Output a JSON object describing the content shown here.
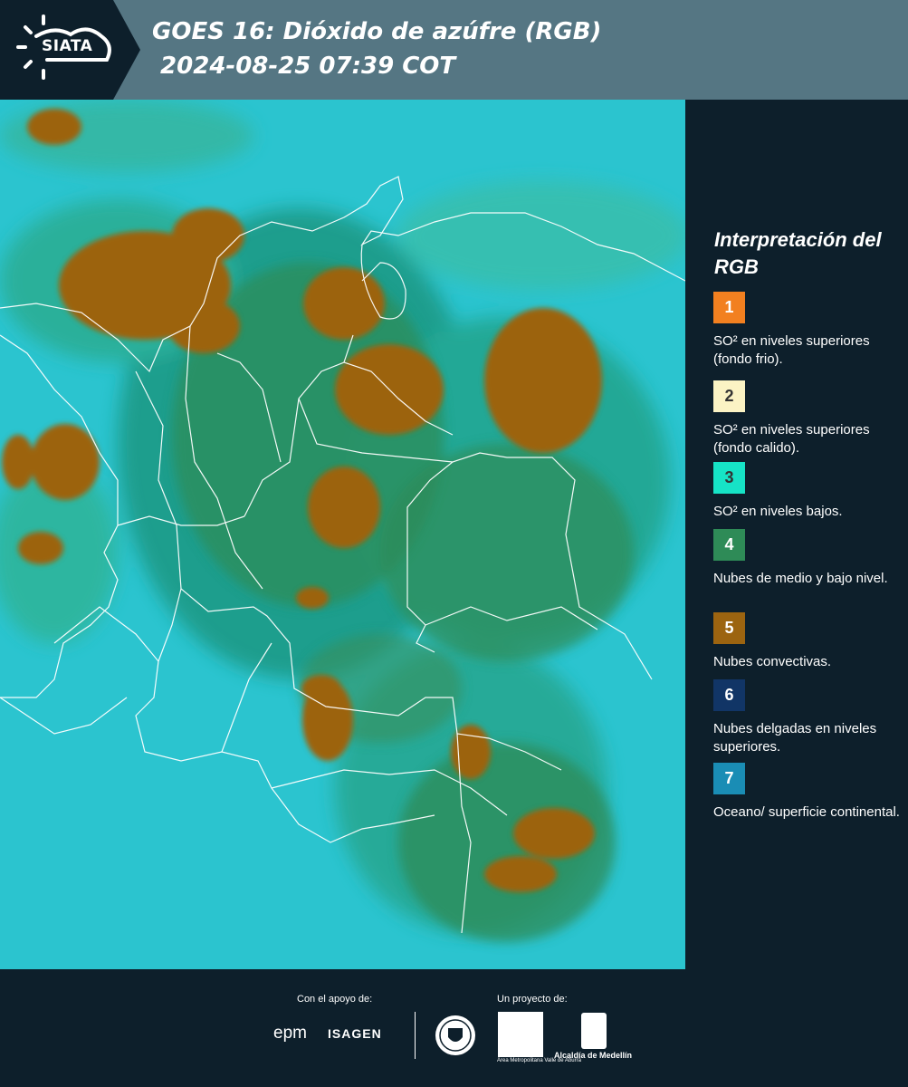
{
  "header": {
    "logo_text": "SIATA",
    "title_line1": "GOES 16: Dióxido de azúfre (RGB)",
    "title_line2": " 2024-08-25 07:39 COT"
  },
  "legend": {
    "title": "Interpretación del RGB",
    "items": [
      {
        "number": "1",
        "color": "#f28020",
        "text": "SO² en niveles superiores (fondo frio)."
      },
      {
        "number": "2",
        "color": "#fbf3c4",
        "text": "SO² en niveles superiores (fondo calido)."
      },
      {
        "number": "3",
        "color": "#16e3c6",
        "text": "SO² en niveles bajos."
      },
      {
        "number": "4",
        "color": "#2e8b57",
        "text": "Nubes de medio y bajo nivel."
      },
      {
        "number": "5",
        "color": "#9c6410",
        "text": "Nubes convectivas."
      },
      {
        "number": "6",
        "color": "#113566",
        "text": "Nubes delgadas en niveles superiores."
      },
      {
        "number": "7",
        "color": "#1a8db5",
        "text": "Oceano/ superficie continental."
      }
    ]
  },
  "footer": {
    "support_label": "Con el apoyo de:",
    "project_label": "Un proyecto de:",
    "sponsor1": "epm",
    "sponsor2": "ISAGEN",
    "partner1": "Área Metropolitana Valle de Aburrá",
    "partner2": "Alcaldía de Medellín"
  },
  "colors": {
    "header_bg": "#557683",
    "panel_bg": "#0d1f2b",
    "ocean": "#2bc4cf",
    "convective": "#9c6410"
  }
}
